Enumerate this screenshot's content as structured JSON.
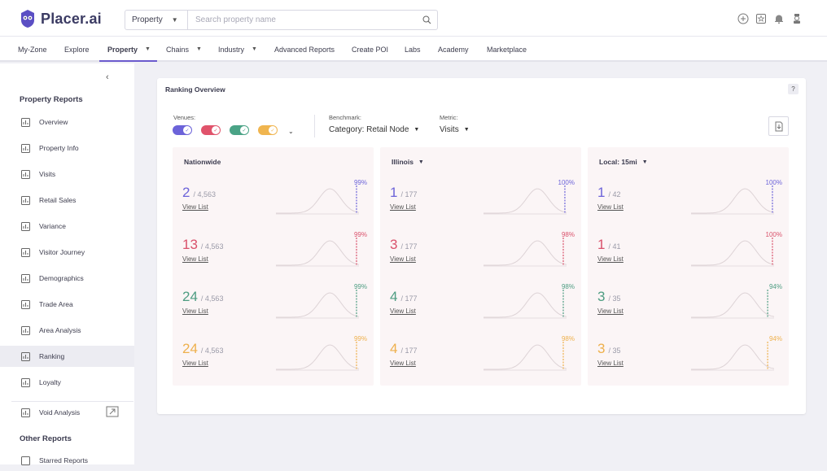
{
  "app": {
    "name": "Placer.ai"
  },
  "search": {
    "type": "Property",
    "placeholder": "Search property name"
  },
  "nav": {
    "items": [
      "My-Zone",
      "Explore",
      "Property",
      "Chains",
      "Industry",
      "Advanced Reports",
      "Create POI",
      "Labs",
      "Academy",
      "Marketplace"
    ],
    "active": "Property"
  },
  "sidebar": {
    "property_heading": "Property Reports",
    "items": [
      {
        "label": "Overview",
        "icon": "chart-icon"
      },
      {
        "label": "Property Info",
        "icon": "building-icon"
      },
      {
        "label": "Visits",
        "icon": "visits-icon"
      },
      {
        "label": "Retail Sales",
        "icon": "coin-icon"
      },
      {
        "label": "Variance",
        "icon": "bar-chart-icon"
      },
      {
        "label": "Visitor Journey",
        "icon": "journey-icon"
      },
      {
        "label": "Demographics",
        "icon": "people-icon"
      },
      {
        "label": "Trade Area",
        "icon": "map-icon"
      },
      {
        "label": "Area Analysis",
        "icon": "target-icon"
      },
      {
        "label": "Ranking",
        "icon": "trophy-icon"
      },
      {
        "label": "Loyalty",
        "icon": "heart-icon"
      },
      {
        "label": "Void Analysis",
        "icon": "void-icon"
      }
    ],
    "active": "Ranking",
    "other_heading": "Other Reports",
    "other_items": [
      {
        "label": "Starred Reports",
        "icon": "star-icon"
      }
    ]
  },
  "card": {
    "title": "Ranking Overview",
    "help": "?",
    "venues_label": "Venues:",
    "benchmark_label": "Benchmark:",
    "benchmark_value": "Category: Retail Node",
    "metric_label": "Metric:",
    "metric_value": "Visits",
    "venue_colors": [
      "#6c63d9",
      "#e0536b",
      "#4aa386",
      "#f0b54f"
    ]
  },
  "columns": [
    {
      "title": "Nationwide",
      "dropdown": false,
      "rows": [
        {
          "rank": "2",
          "total": "/ 4,563",
          "link": "View List",
          "percentile": "99%",
          "color": "#6c63d9"
        },
        {
          "rank": "13",
          "total": "/ 4,563",
          "link": "View List",
          "percentile": "99%",
          "color": "#d9516b"
        },
        {
          "rank": "24",
          "total": "/ 4,563",
          "link": "View List",
          "percentile": "99%",
          "color": "#4e9d82"
        },
        {
          "rank": "24",
          "total": "/ 4,563",
          "link": "View List",
          "percentile": "99%",
          "color": "#eeb04c"
        }
      ]
    },
    {
      "title": "Illinois",
      "dropdown": true,
      "rows": [
        {
          "rank": "1",
          "total": "/ 177",
          "link": "View List",
          "percentile": "100%",
          "color": "#6c63d9"
        },
        {
          "rank": "3",
          "total": "/ 177",
          "link": "View List",
          "percentile": "98%",
          "color": "#d9516b"
        },
        {
          "rank": "4",
          "total": "/ 177",
          "link": "View List",
          "percentile": "98%",
          "color": "#4e9d82"
        },
        {
          "rank": "4",
          "total": "/ 177",
          "link": "View List",
          "percentile": "98%",
          "color": "#eeb04c"
        }
      ]
    },
    {
      "title": "Local: 15mi",
      "dropdown": true,
      "rows": [
        {
          "rank": "1",
          "total": "/ 42",
          "link": "View List",
          "percentile": "100%",
          "color": "#6c63d9"
        },
        {
          "rank": "1",
          "total": "/ 41",
          "link": "View List",
          "percentile": "100%",
          "color": "#d9516b"
        },
        {
          "rank": "3",
          "total": "/ 35",
          "link": "View List",
          "percentile": "94%",
          "color": "#4e9d82"
        },
        {
          "rank": "3",
          "total": "/ 35",
          "link": "View List",
          "percentile": "94%",
          "color": "#eeb04c"
        }
      ]
    }
  ]
}
